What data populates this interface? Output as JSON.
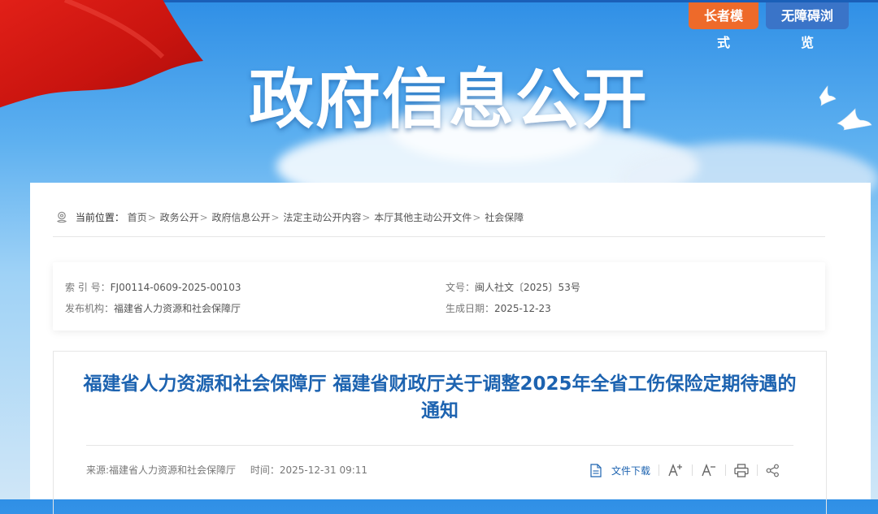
{
  "banner": {
    "title": "政府信息公开",
    "elder_mode": "长者模式",
    "accessibility": "无障碍浏览"
  },
  "breadcrumb": {
    "lead": "当前位置：",
    "items": [
      "首页",
      "政务公开",
      "政府信息公开",
      "法定主动公开内容",
      "本厅其他主动公开文件",
      "社会保障"
    ],
    "separator": ">"
  },
  "meta": {
    "index_label": "索 引 号：",
    "index_value": "FJ00114-0609-2025-00103",
    "doc_no_label": "文号：",
    "doc_no_value": "闽人社文〔2025〕53号",
    "publisher_label": "发布机构：",
    "publisher_value": "福建省人力资源和社会保障厅",
    "date_label": "生成日期：",
    "date_value": "2025-12-23"
  },
  "article": {
    "title": "福建省人力资源和社会保障厅 福建省财政厅关于调整2025年全省工伤保险定期待遇的通知",
    "source": "来源:福建省人力资源和社会保障厅",
    "time_label": "时间：",
    "time_value": "2025-12-31 09:11",
    "download_label": "文件下载"
  },
  "colors": {
    "accent": "#1d63b0",
    "elder_btn": "#ee6a2a",
    "a11y_btn": "#3a74c8"
  },
  "icons": [
    "location-icon",
    "document-icon",
    "font-increase-icon",
    "font-decrease-icon",
    "print-icon",
    "share-icon"
  ]
}
